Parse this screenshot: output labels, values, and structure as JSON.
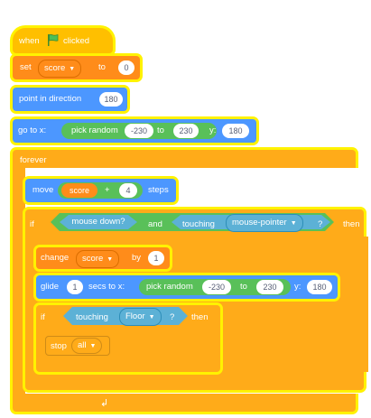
{
  "colors": {
    "events": "#ffbf00",
    "control": "#ffab19",
    "variables": "#ff8c1a",
    "motion": "#4c97ff",
    "operators": "#59c059",
    "sensing": "#5cb1d6",
    "highlight": "#fff200"
  },
  "hat": {
    "when": "when",
    "flag_icon": "green-flag",
    "clicked": "clicked"
  },
  "set_block": {
    "label": "set",
    "variable": "score",
    "to": "to",
    "value": "0"
  },
  "point_block": {
    "label": "point in direction",
    "value": "180"
  },
  "goto_block": {
    "label": "go to x:",
    "random": "pick random",
    "from": "-230",
    "to": "to",
    "to_value": "230",
    "y": "y:",
    "y_value": "180"
  },
  "forever": {
    "label": "forever"
  },
  "move_block": {
    "label": "move",
    "reporter": "score",
    "plus": "+",
    "value": "4",
    "steps": "steps"
  },
  "if1": {
    "label": "if",
    "mouse_down": "mouse down?",
    "and": "and",
    "touching": "touching",
    "target": "mouse-pointer",
    "q": "?",
    "then": "then"
  },
  "change_block": {
    "label": "change",
    "variable": "score",
    "by": "by",
    "value": "1"
  },
  "glide_block": {
    "label": "glide",
    "secs_value": "1",
    "secs": "secs to x:",
    "random": "pick random",
    "from": "-230",
    "to": "to",
    "to_value": "230",
    "y": "y:",
    "y_value": "180"
  },
  "if2": {
    "label": "if",
    "touching": "touching",
    "target": "Floor",
    "q": "?",
    "then": "then"
  },
  "stop_block": {
    "label": "stop",
    "option": "all"
  }
}
